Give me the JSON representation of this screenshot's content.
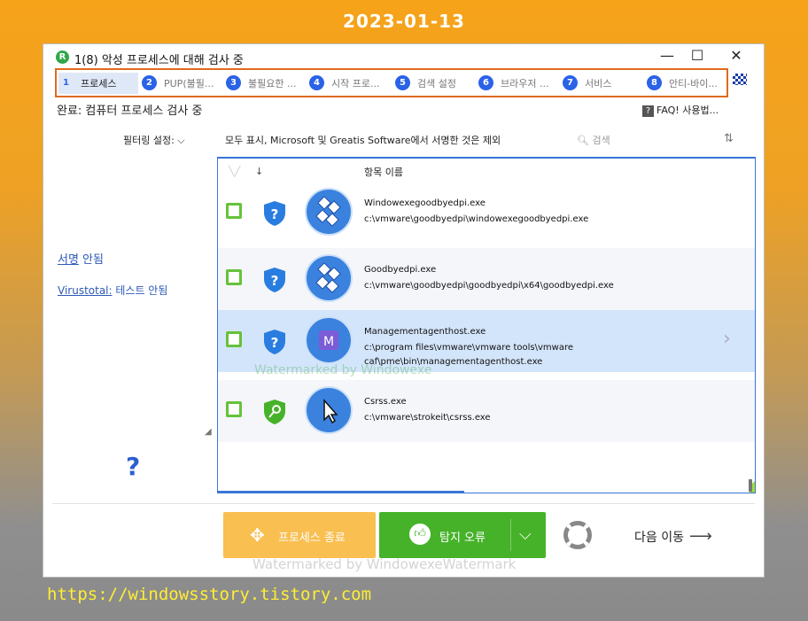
{
  "overlay": {
    "date": "2023-01-13",
    "url": "https://windowsstory.tistory.com",
    "watermark_bottom": "Watermarked by WindowexeWatermark",
    "watermark_mid": "Watermarked by Windowexe"
  },
  "window": {
    "title": "1(8) 악성 프로세스에 대해 검사 중",
    "minimize": "—",
    "maximize": "☐",
    "close": "✕"
  },
  "steps": [
    {
      "num": "1",
      "label": "프로세스",
      "active": true
    },
    {
      "num": "2",
      "label": "PUP(불필..."
    },
    {
      "num": "3",
      "label": "불필요한 ..."
    },
    {
      "num": "4",
      "label": "시작 프로..."
    },
    {
      "num": "5",
      "label": "검색 설정"
    },
    {
      "num": "6",
      "label": "브라우저 ..."
    },
    {
      "num": "7",
      "label": "서비스"
    },
    {
      "num": "8",
      "label": "안티-바이..."
    }
  ],
  "status": {
    "text": "완료: 컴퓨터 프로세스 검사 중",
    "faq": "FAQ! 사용법..."
  },
  "filter": {
    "label": "필터링 설정: ⌵",
    "value": "모두 표시, Microsoft 및 Greatis Software에서 서명한 것은 제외",
    "search_placeholder": "검색"
  },
  "left": {
    "signature_link": "서명",
    "signature_value": " 안됨",
    "virustotal_link": "Virustotal:",
    "virustotal_value": " 테스트 안됨",
    "help": "?"
  },
  "table": {
    "header_name": "항목 이름",
    "rows": [
      {
        "name": "Windowexegoodbyedpi.exe",
        "path": "c:\\vmware\\goodbyedpi\\windowexegoodbyedpi.exe",
        "icon": "goodbyedpi-icon",
        "shield": "unknown"
      },
      {
        "name": "Goodbyedpi.exe",
        "path": "c:\\vmware\\goodbyedpi\\goodbyedpi\\x64\\goodbyedpi.exe",
        "icon": "goodbyedpi-icon",
        "shield": "unknown"
      },
      {
        "name": "Managementagenthost.exe",
        "path": "c:\\program files\\vmware\\vmware tools\\vmware caf\\pme\\bin\\managementagenthost.exe",
        "icon": "vmware-icon",
        "shield": "unknown"
      },
      {
        "name": "Csrss.exe",
        "path": "c:\\vmware\\strokeit\\csrss.exe",
        "icon": "cursor-icon",
        "shield": "verified"
      }
    ]
  },
  "footer": {
    "kill_label": "프로세스 종료",
    "false_positive_label": "탐지 오류",
    "next_label": "다음 이동"
  },
  "colors": {
    "accent": "#2a62e8",
    "green": "#46b22a",
    "orange": "#f9bf51",
    "highlight_border": "#e06a1e"
  }
}
